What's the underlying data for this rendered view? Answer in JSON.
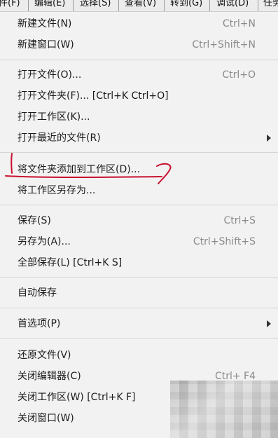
{
  "menubar": {
    "items": [
      "件(F)",
      "编辑(E)",
      "选择(S)",
      "查看(V)",
      "转到(G)",
      "调试(D)",
      "任务"
    ]
  },
  "menu": {
    "new_file": {
      "label": "新建文件(N)",
      "shortcut": "Ctrl+N"
    },
    "new_window": {
      "label": "新建窗口(W)",
      "shortcut": "Ctrl+Shift+N"
    },
    "open_file": {
      "label": "打开文件(O)...",
      "shortcut": "Ctrl+O"
    },
    "open_folder": {
      "label": "打开文件夹(F)... [Ctrl+K Ctrl+O]"
    },
    "open_workspace": {
      "label": "打开工作区(K)..."
    },
    "open_recent": {
      "label": "打开最近的文件(R)"
    },
    "add_folder_to_workspace": {
      "label": "将文件夹添加到工作区(D)..."
    },
    "save_workspace_as": {
      "label": "将工作区另存为..."
    },
    "save": {
      "label": "保存(S)",
      "shortcut": "Ctrl+S"
    },
    "save_as": {
      "label": "另存为(A)...",
      "shortcut": "Ctrl+Shift+S"
    },
    "save_all": {
      "label": "全部保存(L) [Ctrl+K S]"
    },
    "auto_save": {
      "label": "自动保存"
    },
    "preferences": {
      "label": "首选项(P)"
    },
    "revert_file": {
      "label": "还原文件(V)"
    },
    "close_editor": {
      "label": "关闭编辑器(C)",
      "shortcut": "Ctrl+  F4"
    },
    "close_workspace": {
      "label": "关闭工作区(W) [Ctrl+K F]"
    },
    "close_window": {
      "label": "关闭窗口(W)"
    }
  },
  "colors": {
    "background": "#f2f2f2",
    "shortcut_text": "#8a8a8a",
    "annotation": "#c8102e"
  }
}
